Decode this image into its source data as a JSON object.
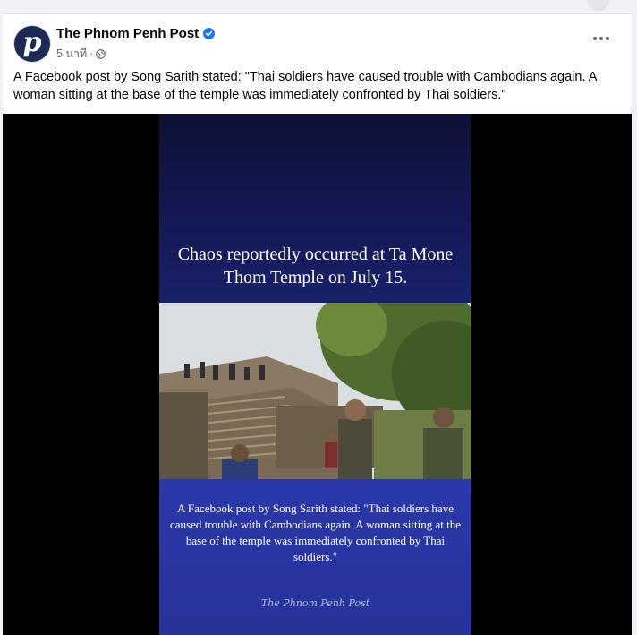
{
  "post": {
    "page_name": "The Phnom Penh Post",
    "avatar_letter": "p",
    "timestamp": "5 นาที",
    "separator": "·",
    "text": "A Facebook post by Song Sarith stated: \"Thai soldiers have caused trouble with Cambodians again. A woman sitting at the base of the temple was immediately confronted by Thai soldiers.\""
  },
  "video": {
    "title": "Chaos reportedly occurred at Ta Mone Thom Temple on July 15.",
    "caption": "A Facebook post by Song Sarith stated: \"Thai soldiers have caused trouble with Cambodians again. A woman sitting at the base of the temple was immediately confronted by Thai soldiers.\"",
    "watermark": "The Phnom Penh Post"
  },
  "icons": {
    "verified": "verified-badge-icon",
    "privacy": "globe-icon",
    "more": "more-options-icon"
  },
  "colors": {
    "verified_blue": "#1877f2",
    "text": "#050505",
    "muted": "#65676b",
    "video_blue": "#2b3ab0"
  }
}
